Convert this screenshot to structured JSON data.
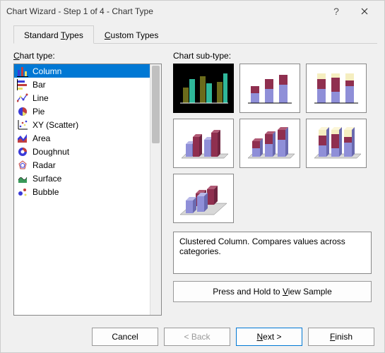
{
  "window": {
    "title": "Chart Wizard - Step 1 of 4 - Chart Type",
    "help_icon": "help-icon",
    "close_icon": "close-icon"
  },
  "tabs": [
    {
      "label_pre": "Standard ",
      "accel": "T",
      "label_post": "ypes",
      "active": true
    },
    {
      "label_pre": "",
      "accel": "C",
      "label_post": "ustom Types",
      "active": false
    }
  ],
  "left": {
    "label_pre": "",
    "label_accel": "C",
    "label_post": "hart type:"
  },
  "chart_types": [
    {
      "name": "Column",
      "icon": "column-icon",
      "selected": true
    },
    {
      "name": "Bar",
      "icon": "bar-icon",
      "selected": false
    },
    {
      "name": "Line",
      "icon": "line-icon",
      "selected": false
    },
    {
      "name": "Pie",
      "icon": "pie-icon",
      "selected": false
    },
    {
      "name": "XY (Scatter)",
      "icon": "scatter-icon",
      "selected": false
    },
    {
      "name": "Area",
      "icon": "area-icon",
      "selected": false
    },
    {
      "name": "Doughnut",
      "icon": "doughnut-icon",
      "selected": false
    },
    {
      "name": "Radar",
      "icon": "radar-icon",
      "selected": false
    },
    {
      "name": "Surface",
      "icon": "surface-icon",
      "selected": false
    },
    {
      "name": "Bubble",
      "icon": "bubble-icon",
      "selected": false
    }
  ],
  "right": {
    "label": "Chart sub-type:"
  },
  "subtypes": [
    {
      "id": "clustered-column",
      "selected": true
    },
    {
      "id": "stacked-column",
      "selected": false
    },
    {
      "id": "100-stacked-column",
      "selected": false
    },
    {
      "id": "clustered-column-3d",
      "selected": false
    },
    {
      "id": "stacked-column-3d",
      "selected": false
    },
    {
      "id": "100-stacked-column-3d",
      "selected": false
    },
    {
      "id": "column-3d",
      "selected": false
    }
  ],
  "description": "Clustered Column. Compares values across categories.",
  "sample": {
    "pre": "Press and Hold to ",
    "accel": "V",
    "post": "iew Sample"
  },
  "buttons": {
    "cancel": {
      "label": "Cancel"
    },
    "back": {
      "label": "< Back",
      "disabled": true
    },
    "next": {
      "pre": "",
      "accel": "N",
      "post": "ext >",
      "default": true
    },
    "finish": {
      "pre": "",
      "accel": "F",
      "post": "inish"
    }
  },
  "colors": {
    "accent": "#0078d4",
    "olive1": "#6b6b1b",
    "olive2": "#9b9b3b",
    "teal1": "#2fb79a",
    "teal2": "#6fd8c0",
    "blue1": "#8f8fd8",
    "maroon": "#8f2f4f",
    "cream": "#f5eec0"
  }
}
